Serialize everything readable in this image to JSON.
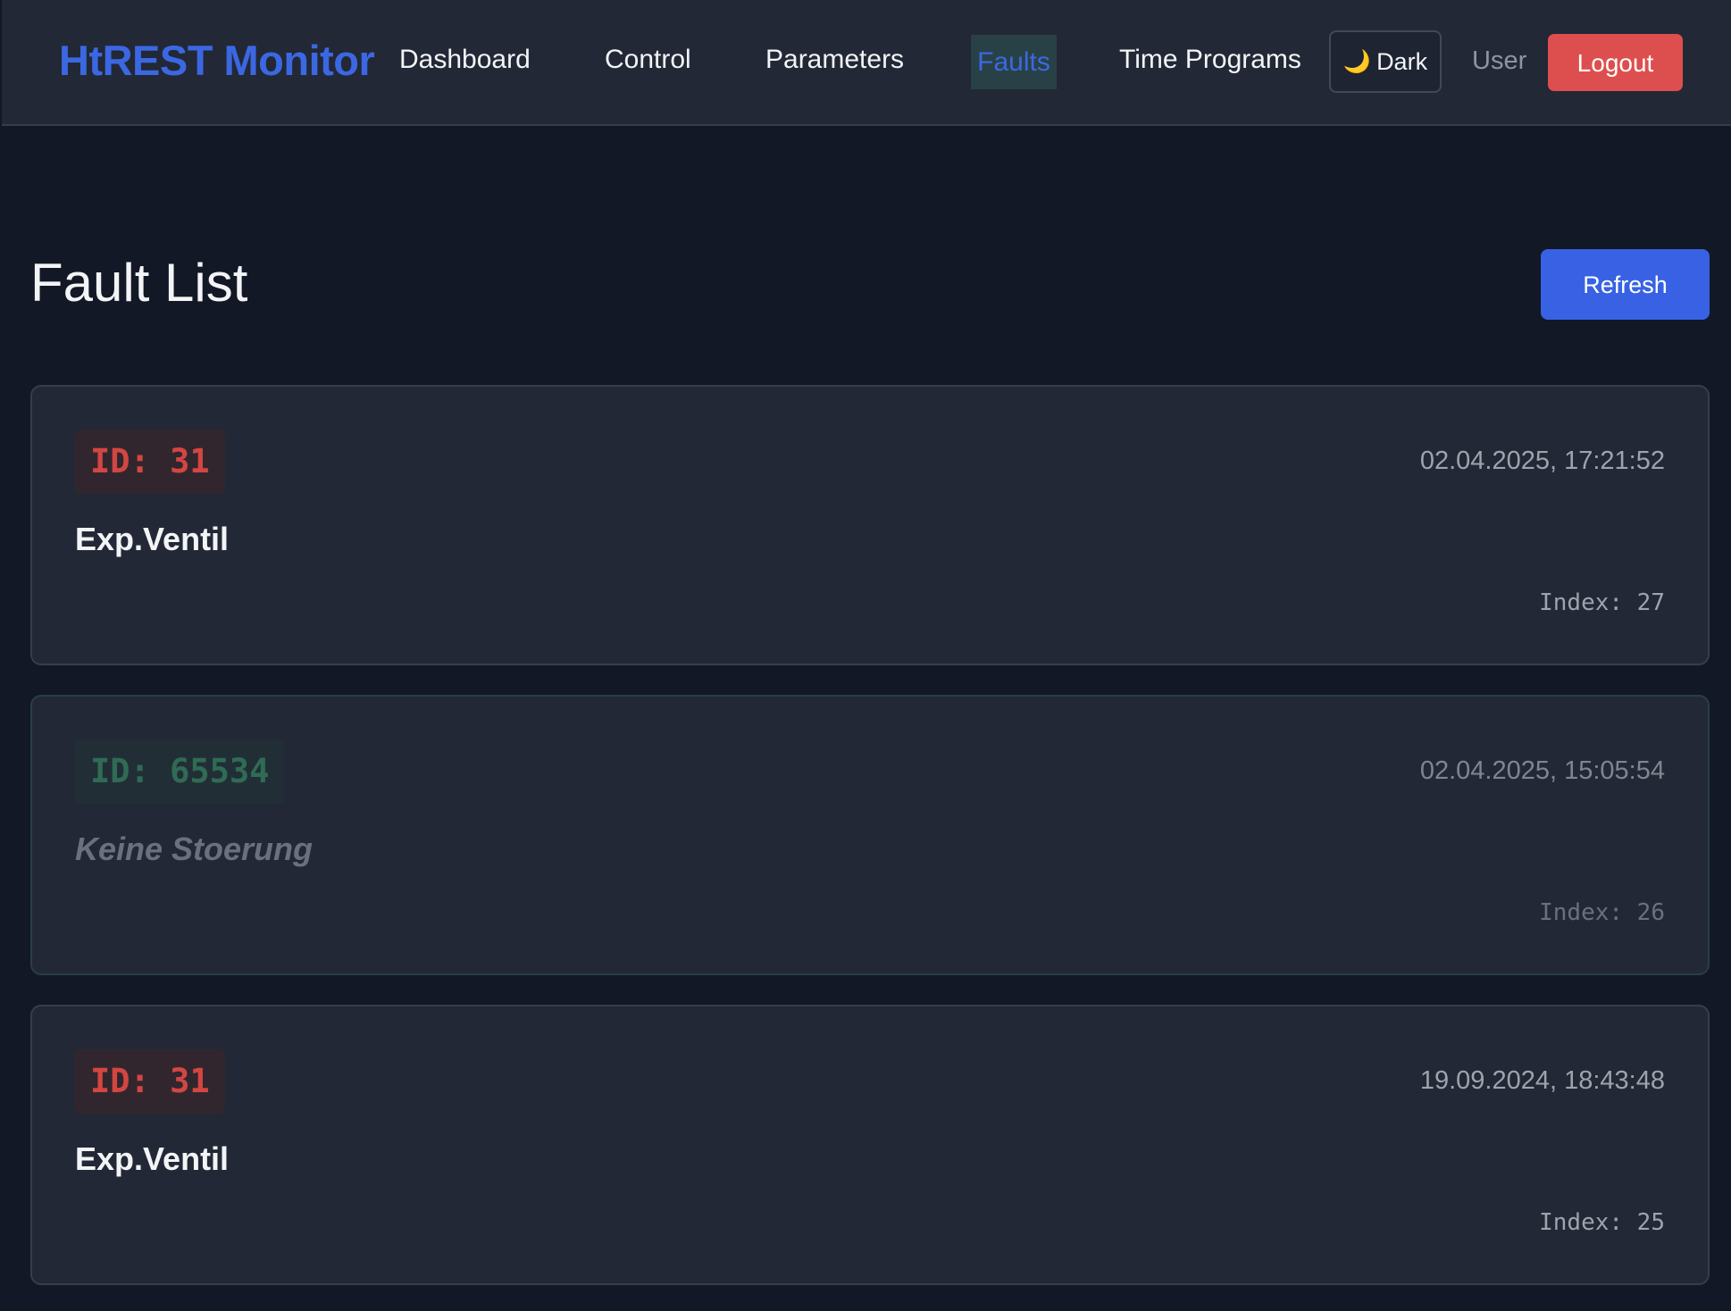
{
  "navbar": {
    "brand": "HtREST Monitor",
    "links": {
      "dashboard": "Dashboard",
      "control": "Control",
      "parameters": "Parameters",
      "faults": "Faults",
      "time_programs": "Time Programs"
    },
    "active_link": "Faults",
    "theme_toggle": {
      "icon": "moon-icon",
      "glyph": "🌙",
      "label": "Dark"
    },
    "user_label": "User",
    "logout_label": "Logout"
  },
  "page": {
    "title": "Fault List",
    "refresh_label": "Refresh"
  },
  "faults": [
    {
      "id_text": "ID: 31",
      "timestamp": "02.04.2025, 17:21:52",
      "description": "Exp.Ventil",
      "index_text": "Index: 27",
      "status": "fault"
    },
    {
      "id_text": "ID: 65534",
      "timestamp": "02.04.2025, 15:05:54",
      "description": "Keine Stoerung",
      "index_text": "Index: 26",
      "status": "no-fault"
    },
    {
      "id_text": "ID: 31",
      "timestamp": "19.09.2024, 18:43:48",
      "description": "Exp.Ventil",
      "index_text": "Index: 25",
      "status": "fault"
    }
  ],
  "colors": {
    "background": "#121826",
    "surface": "#222836",
    "brand": "#3b68e2",
    "primary_button": "#3862e3",
    "danger_button": "#dd4f4e",
    "fault_id": "#d34641",
    "no_fault_id": "#2f6b55",
    "active_nav_bg": "#284146"
  }
}
